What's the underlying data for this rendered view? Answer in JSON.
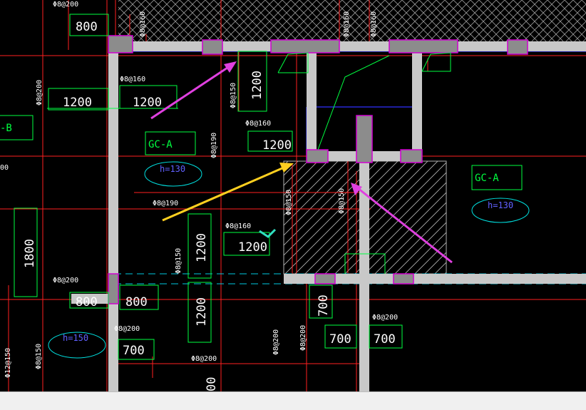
{
  "colors": {
    "background": "#000000",
    "wall": "#c0c0c0",
    "column": "#808080",
    "column_edge": "#d000d0",
    "rebar": "#ff2020",
    "dim": "#00ff40",
    "annotation_box": "#00ff40",
    "ellipse": "#00e0e0",
    "dashed": "#00c8e0",
    "arrow_magenta": "#e040e0",
    "arrow_yellow": "#ffd020",
    "check": "#30e0c0",
    "opening_blue": "#3030ff"
  },
  "rebar_labels": {
    "r1": "Φ8@200",
    "r2": "Φ8@160",
    "r3": "Φ8@160",
    "r4": "Φ8@160",
    "r5": "Φ8@200",
    "r6": "Φ8@160",
    "r7": "Φ8@150",
    "r8": "Φ8@200",
    "r9": "Φ8@160",
    "r10": "Φ8@190",
    "r11": "Φ8@190",
    "r12": "Φ8@150",
    "r13": "Φ8@150",
    "r14": "Φ8@160",
    "r15": "Φ8@150",
    "r16": "Φ8@200",
    "r17": "Φ8@200",
    "r18": "Φ12@150",
    "r19": "Φ8@150",
    "r20": "Φ8@200",
    "r21": "Φ8@200",
    "r22": "Φ8@200",
    "r23": "Φ8@200"
  },
  "dimensions": {
    "d1": "800",
    "d2": "1200",
    "d3": "1200",
    "d4": "1200",
    "d5": "1200",
    "d6": "1800",
    "d7": "1200",
    "d8": "1200",
    "d9": "1200",
    "d10": "800",
    "d11": "800",
    "d12": "700",
    "d13": "700",
    "d14": "700",
    "d15": "700",
    "d16": "00"
  },
  "annotations": {
    "gc_left": "GC-A",
    "gc_right": "GC-A",
    "b_left": "-B",
    "h_left": "h=130",
    "h_right": "h=130",
    "h_bottom": "h=150",
    "left_edge": "00"
  }
}
